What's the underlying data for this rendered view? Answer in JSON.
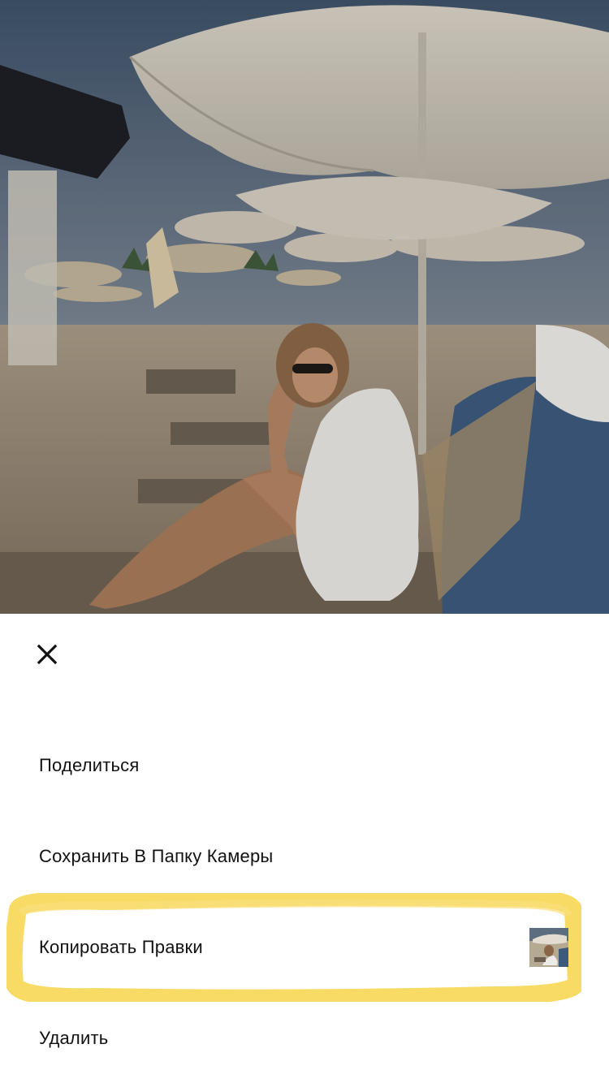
{
  "photo": {
    "description_icon": "beach-photo-icon"
  },
  "sheet": {
    "close_icon": "close-icon",
    "items": [
      {
        "label": "Поделиться"
      },
      {
        "label": "Сохранить В Папку Камеры"
      },
      {
        "label": "Копировать Правки",
        "thumbnail_icon": "photo-thumbnail-icon"
      },
      {
        "label": "Удалить"
      }
    ]
  },
  "colors": {
    "background": "#ffffff",
    "text": "#111111",
    "highlight": "#f7d54a"
  }
}
